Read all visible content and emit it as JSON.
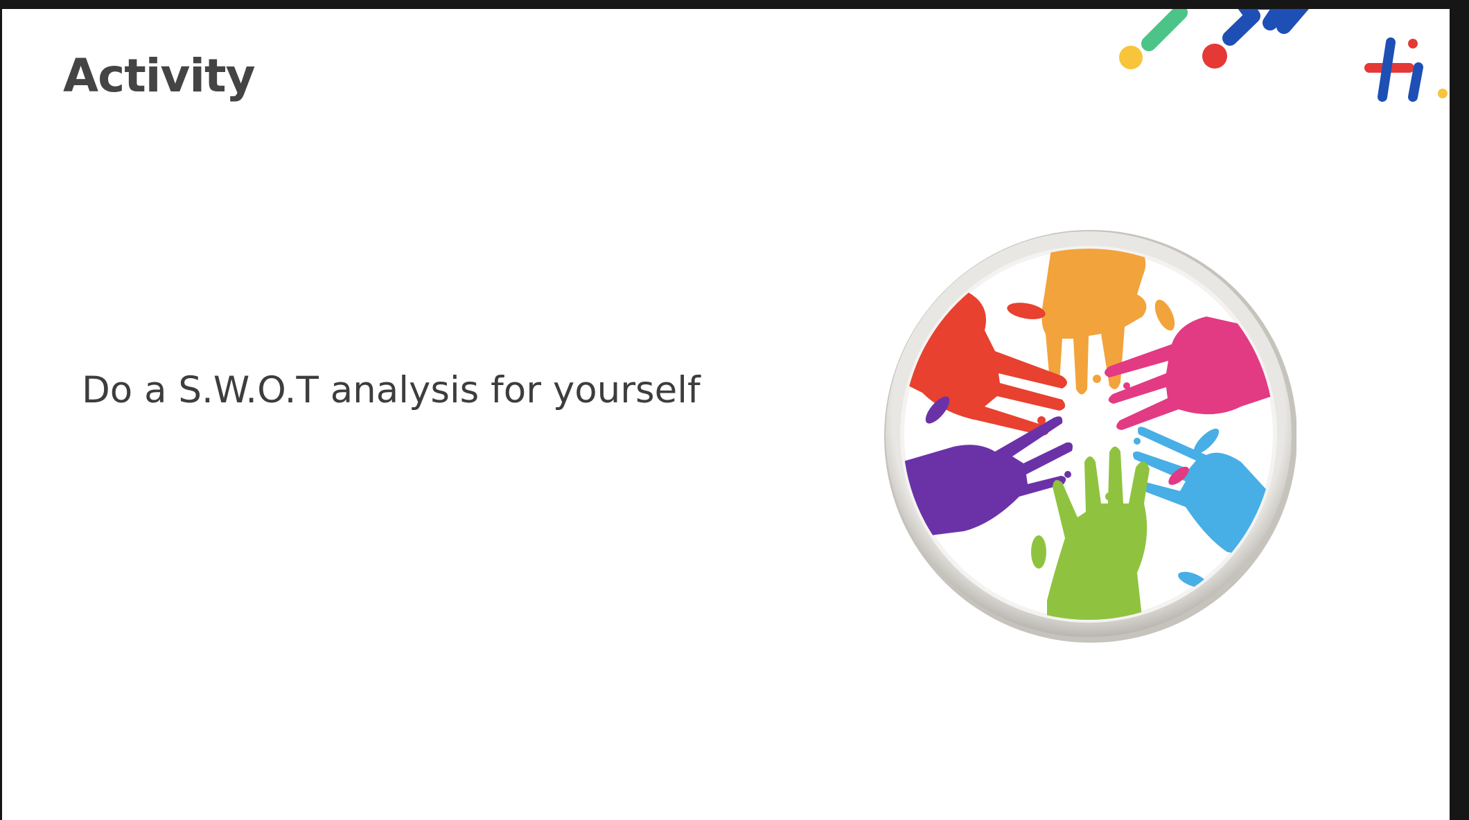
{
  "slide": {
    "title": "Activity",
    "body": "Do a S.W.O.T analysis for yourself"
  },
  "brand": {
    "logo_icon": "hi-logo-icon",
    "colors": {
      "blue": "#1e4fb5",
      "red": "#e53935",
      "green": "#4cc487",
      "yellow": "#f7c43a"
    }
  },
  "illustration": {
    "icon": "colorful-hands-circle-icon",
    "colors": {
      "orange": "#f2a33c",
      "red": "#e8412f",
      "pink": "#e23a83",
      "purple": "#6b32a8",
      "green": "#8fc33f",
      "blue": "#48aee6",
      "frame": "#d7d4cf"
    }
  }
}
